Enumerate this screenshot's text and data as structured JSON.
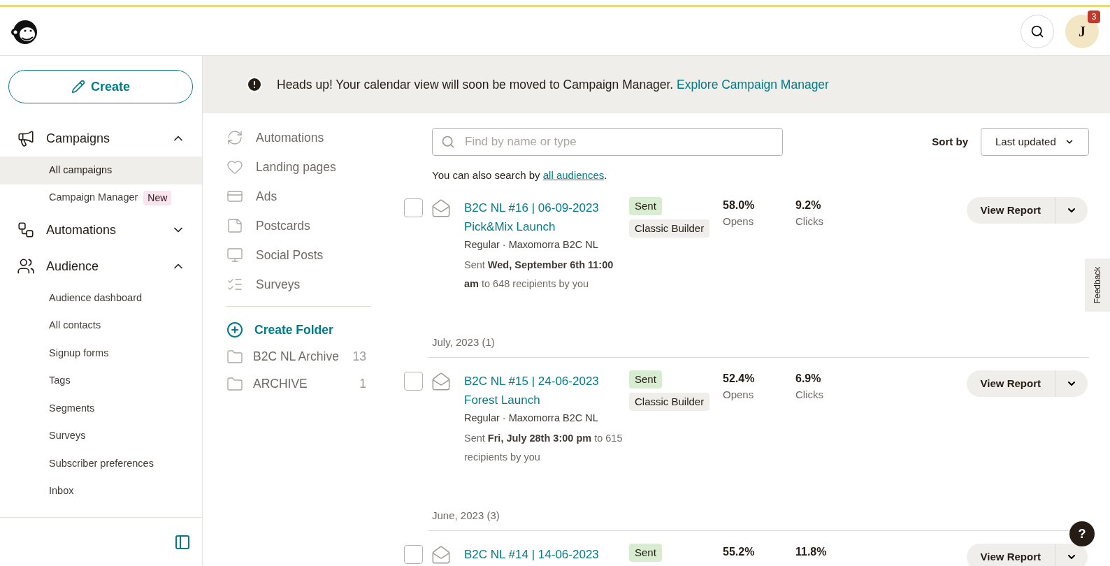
{
  "header": {
    "avatar_initial": "J",
    "notification_count": "3"
  },
  "sidebar": {
    "create_label": "Create",
    "groups": [
      {
        "kind": "campaigns",
        "label": "Campaigns",
        "expanded": true,
        "items": [
          {
            "label": "All campaigns",
            "selected": true
          },
          {
            "label": "Campaign Manager",
            "selected": false,
            "badge": "New"
          }
        ]
      },
      {
        "kind": "automations",
        "label": "Automations",
        "expanded": false
      },
      {
        "kind": "audience",
        "label": "Audience",
        "expanded": true,
        "items": [
          {
            "label": "Audience dashboard",
            "selected": false
          },
          {
            "label": "All contacts",
            "selected": false
          },
          {
            "label": "Signup forms",
            "selected": false
          },
          {
            "label": "Tags",
            "selected": false
          },
          {
            "label": "Segments",
            "selected": false
          },
          {
            "label": "Surveys",
            "selected": false
          },
          {
            "label": "Subscriber preferences",
            "selected": false
          },
          {
            "label": "Inbox",
            "selected": false
          }
        ]
      }
    ]
  },
  "banner": {
    "text": "Heads up! Your calendar view will soon be moved to Campaign Manager.",
    "link": "Explore Campaign Manager"
  },
  "types": [
    {
      "kind": "automation",
      "label": "Automations"
    },
    {
      "kind": "landing",
      "label": "Landing pages"
    },
    {
      "kind": "ads",
      "label": "Ads"
    },
    {
      "kind": "postcard",
      "label": "Postcards"
    },
    {
      "kind": "social",
      "label": "Social Posts"
    },
    {
      "kind": "survey",
      "label": "Surveys"
    }
  ],
  "create_folder": "Create Folder",
  "folders": [
    {
      "name": "B2C NL Archive",
      "count": "13"
    },
    {
      "name": "ARCHIVE",
      "count": "1"
    }
  ],
  "search": {
    "placeholder": "Find by name or type",
    "hint": "You can also search by",
    "hint_link": "all audiences",
    "hint_end": "."
  },
  "sort": {
    "label": "Sort by",
    "value": "Last updated"
  },
  "groups": [
    {
      "campaigns": [
        {
          "title": "B2C NL #16 | 06-09-2023",
          "subtitle": "Pick&Mix Launch",
          "checked": false,
          "meta": "Regular · Maxomorra B2C NL",
          "sent": "Sent **Wed, September 6th 11:00 am** to 648 recipients by you",
          "status": "Sent",
          "builder": "Classic Builder",
          "opens": "58.0%",
          "opens_label": "Opens",
          "clicks": "9.2%",
          "clicks_label": "Clicks",
          "action": "View Report"
        }
      ]
    },
    {
      "heading": "July, 2023 (1)",
      "campaigns": [
        {
          "title": "B2C NL #15 | 24-06-2023",
          "subtitle": "Forest Launch",
          "checked": false,
          "meta": "Regular · Maxomorra B2C NL",
          "sent": "Sent **Fri, July 28th 3:00 pm** to 615 recipients by you",
          "status": "Sent",
          "builder": "Classic Builder",
          "opens": "52.4%",
          "opens_label": "Opens",
          "clicks": "6.9%",
          "clicks_label": "Clicks",
          "action": "View Report"
        }
      ]
    },
    {
      "heading": "June, 2023 (3)",
      "campaigns": [
        {
          "title": "B2C NL #14 | 14-06-2023",
          "checked": false,
          "status": "Sent",
          "opens": "55.2%",
          "clicks": "11.8%",
          "action": "View Report"
        }
      ]
    }
  ],
  "feedback": "Feedback",
  "help": "?"
}
